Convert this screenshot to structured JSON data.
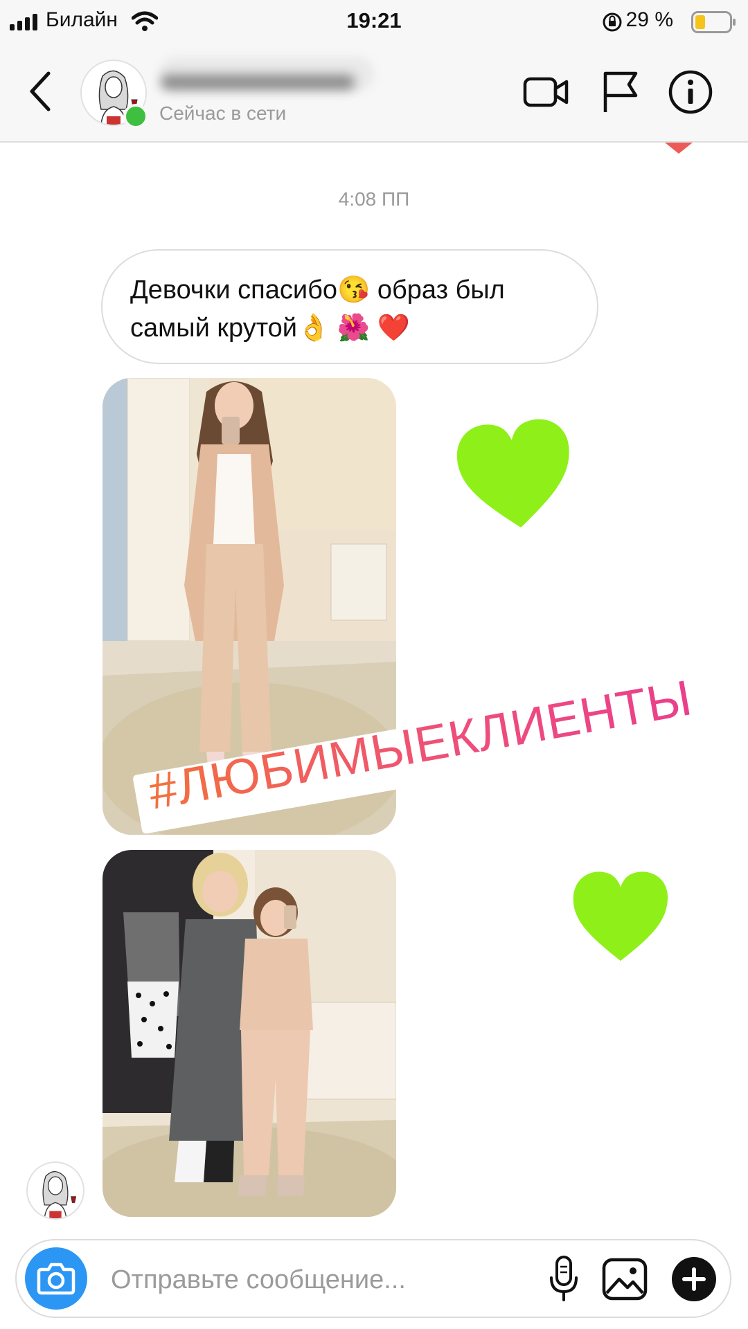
{
  "status_bar": {
    "carrier": "Билайн",
    "time": "19:21",
    "battery": "29 %"
  },
  "header": {
    "status": "Сейчас в сети"
  },
  "chat": {
    "timestamp": "4:08 ПП",
    "message_line1": "Девочки спасибо😘 образ был",
    "message_line2": "самый крутой👌 🌺 ❤️",
    "hashtag": "#ЛЮБИМЫЕКЛИЕНТЫ"
  },
  "composer": {
    "placeholder": "Отправьте сообщение..."
  },
  "colors": {
    "online": "#3fbf3f",
    "camera_button": "#2c96f4",
    "heart": "#8ef018",
    "hashtag_start": "#f3713c",
    "hashtag_end": "#ea3f8c"
  },
  "icons": [
    "back-arrow-icon",
    "video-call-icon",
    "flag-icon",
    "info-icon",
    "camera-icon",
    "microphone-icon",
    "gallery-icon",
    "plus-icon",
    "heart-sticker-icon"
  ]
}
